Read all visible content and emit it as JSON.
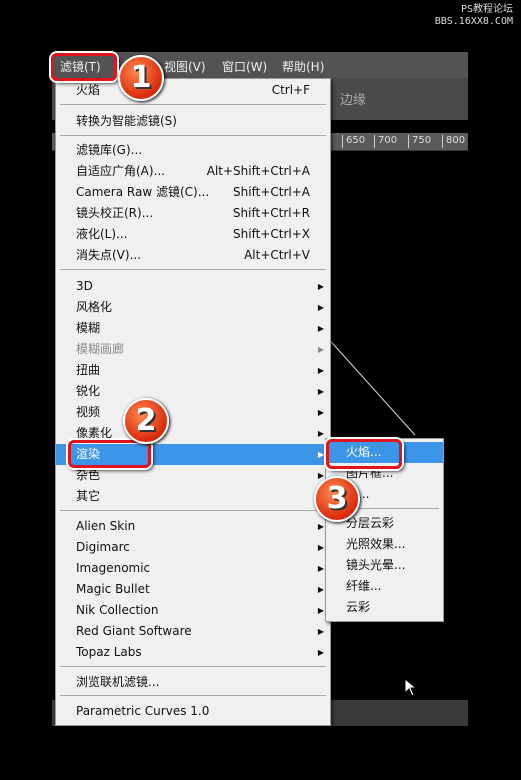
{
  "watermark": {
    "line1": "PS教程论坛",
    "line2": "BBS.16XX8.COM"
  },
  "menubar": [
    "滤镜(T)",
    "视图(V)",
    "窗口(W)",
    "帮助(H)"
  ],
  "options_text": "边缘",
  "ruler": [
    "650",
    "700",
    "750",
    "800"
  ],
  "main_menu": [
    {
      "label": "火焰",
      "shortcut": "Ctrl+F"
    },
    {
      "label": "转换为智能滤镜(S)"
    },
    {
      "label": "滤镜库(G)..."
    },
    {
      "label": "自适应广角(A)...",
      "shortcut": "Alt+Shift+Ctrl+A"
    },
    {
      "label": "Camera Raw 滤镜(C)...",
      "shortcut": "Shift+Ctrl+A"
    },
    {
      "label": "镜头校正(R)...",
      "shortcut": "Shift+Ctrl+R"
    },
    {
      "label": "液化(L)...",
      "shortcut": "Shift+Ctrl+X"
    },
    {
      "label": "消失点(V)...",
      "shortcut": "Alt+Ctrl+V"
    },
    {
      "label": "3D"
    },
    {
      "label": "风格化"
    },
    {
      "label": "模糊"
    },
    {
      "label": "模糊画廊",
      "disabled": true
    },
    {
      "label": "扭曲"
    },
    {
      "label": "锐化"
    },
    {
      "label": "视频"
    },
    {
      "label": "像素化"
    },
    {
      "label": "渲染",
      "highlighted": true
    },
    {
      "label": "杂色"
    },
    {
      "label": "其它"
    },
    {
      "label": "Alien Skin"
    },
    {
      "label": "Digimarc"
    },
    {
      "label": "Imagenomic"
    },
    {
      "label": "Magic Bullet"
    },
    {
      "label": "Nik Collection"
    },
    {
      "label": "Red Giant Software"
    },
    {
      "label": "Topaz Labs"
    },
    {
      "label": "浏览联机滤镜..."
    },
    {
      "label": "Parametric Curves 1.0"
    }
  ],
  "sub_menu": [
    "火焰...",
    "图片框...",
    "树...",
    "分层云彩",
    "光照效果...",
    "镜头光晕...",
    "纤维...",
    "云彩"
  ],
  "badges": [
    "1",
    "2",
    "3"
  ],
  "colors": {
    "highlight": "#3d95e8",
    "callout": "#e0141c"
  }
}
